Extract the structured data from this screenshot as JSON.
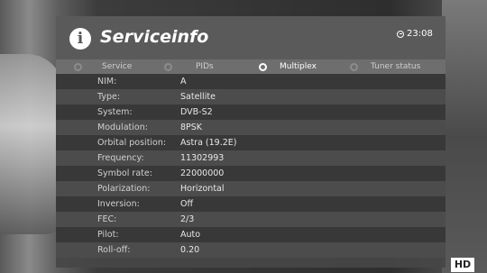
{
  "header": {
    "title": "Serviceinfo",
    "clock": "23:08"
  },
  "tabs": [
    {
      "label": "Service",
      "active": false
    },
    {
      "label": "PIDs",
      "active": false
    },
    {
      "label": "Multiplex",
      "active": true
    },
    {
      "label": "Tuner status",
      "active": false
    }
  ],
  "rows": [
    {
      "key": "NIM:",
      "value": "A"
    },
    {
      "key": "Type:",
      "value": "Satellite"
    },
    {
      "key": "System:",
      "value": "DVB-S2"
    },
    {
      "key": "Modulation:",
      "value": "8PSK"
    },
    {
      "key": "Orbital position:",
      "value": "Astra (19.2E)"
    },
    {
      "key": "Frequency:",
      "value": "11302993"
    },
    {
      "key": "Symbol rate:",
      "value": "22000000"
    },
    {
      "key": "Polarization:",
      "value": "Horizontal"
    },
    {
      "key": "Inversion:",
      "value": "Off"
    },
    {
      "key": "FEC:",
      "value": "2/3"
    },
    {
      "key": "Pilot:",
      "value": "Auto"
    },
    {
      "key": "Roll-off:",
      "value": "0.20"
    }
  ],
  "badge": "HD",
  "colors": {
    "panel": "#464646",
    "header": "#5a5a5a",
    "tab_bar": "#6e6e6e",
    "row_dark": "#383838",
    "row_light": "#4c4c4c"
  }
}
